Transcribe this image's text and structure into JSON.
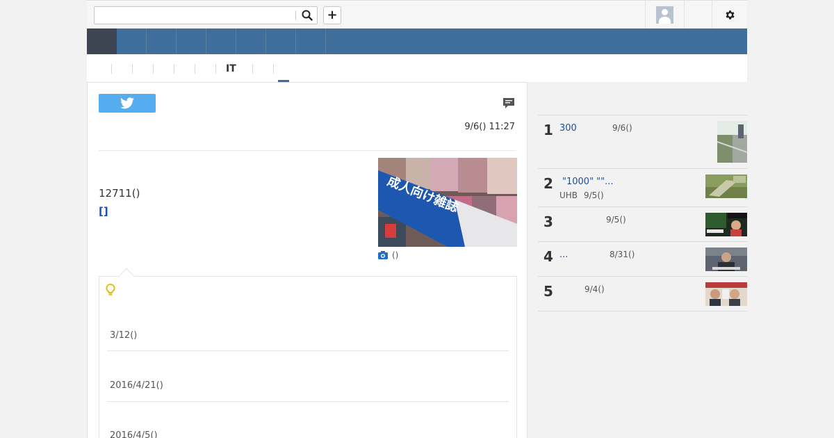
{
  "topbar": {
    "search": {
      "value": "",
      "placeholder": ""
    },
    "add_label": "+"
  },
  "subnav": {
    "tabs": [
      "",
      "",
      "",
      "",
      "",
      "IT",
      ""
    ]
  },
  "article": {
    "timestamp": "9/6() 11:27",
    "count_text": "12711()",
    "link_text": "[]",
    "photo_caption": "()"
  },
  "related": {
    "items": [
      {
        "date": "3/12()"
      },
      {
        "date": "2016/4/21()"
      },
      {
        "date": "2016/4/5()"
      }
    ]
  },
  "ranking": {
    "items": [
      {
        "rank": "1",
        "title": "300",
        "source": "",
        "date": "9/6()"
      },
      {
        "rank": "2",
        "title": "\"1000\" \"\"...",
        "source": "UHB",
        "date": "9/5()"
      },
      {
        "rank": "3",
        "title": "",
        "source": "",
        "date": "9/5()"
      },
      {
        "rank": "4",
        "title": "...",
        "source": "",
        "date": "8/31()"
      },
      {
        "rank": "5",
        "title": "",
        "source": "",
        "date": "9/4()"
      }
    ]
  },
  "colors": {
    "nav_blue": "#3f6e9c",
    "nav_active": "#3d4552",
    "twitter_blue": "#55acee",
    "link_blue": "#1a4fb4",
    "bulb_yellow": "#e8b90f"
  },
  "icons": [
    "search-icon",
    "plus-icon",
    "avatar-icon",
    "gear-icon",
    "twitter-icon",
    "comment-icon",
    "camera-icon",
    "lightbulb-icon"
  ]
}
